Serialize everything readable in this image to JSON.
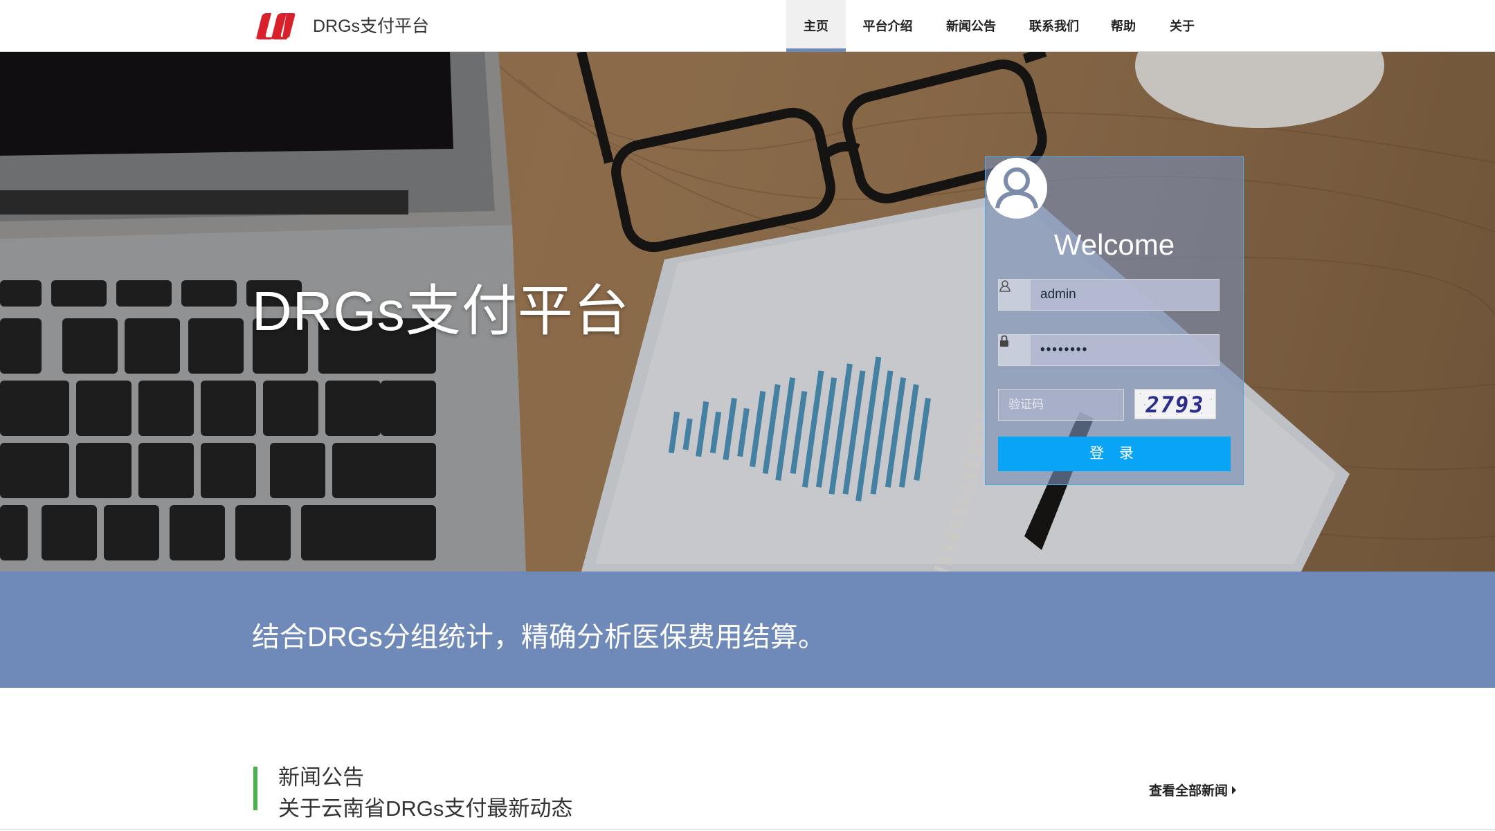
{
  "header": {
    "brand": "DRGs支付平台",
    "logo_icon": "union-logo-icon",
    "nav": [
      {
        "label": "主页",
        "active": true
      },
      {
        "label": "平台介绍",
        "active": false
      },
      {
        "label": "新闻公告",
        "active": false
      },
      {
        "label": "联系我们",
        "active": false
      },
      {
        "label": "帮助",
        "active": false
      },
      {
        "label": "关于",
        "active": false
      }
    ]
  },
  "hero": {
    "title": "DRGs支付平台"
  },
  "login": {
    "welcome": "Welcome",
    "username_value": "admin",
    "password_value": "••••••••",
    "captcha_placeholder": "验证码",
    "captcha_code": "2793",
    "submit_label": "登 录",
    "accent_color": "#0aa4f6"
  },
  "band": {
    "text": "结合DRGs分组统计，精确分析医保费用结算。",
    "color": "#6f89b8"
  },
  "news": {
    "title": "新闻公告",
    "subtitle": "关于云南省DRGs支付最新动态",
    "more_label": "查看全部新闻",
    "accent_color": "#4caf50"
  }
}
